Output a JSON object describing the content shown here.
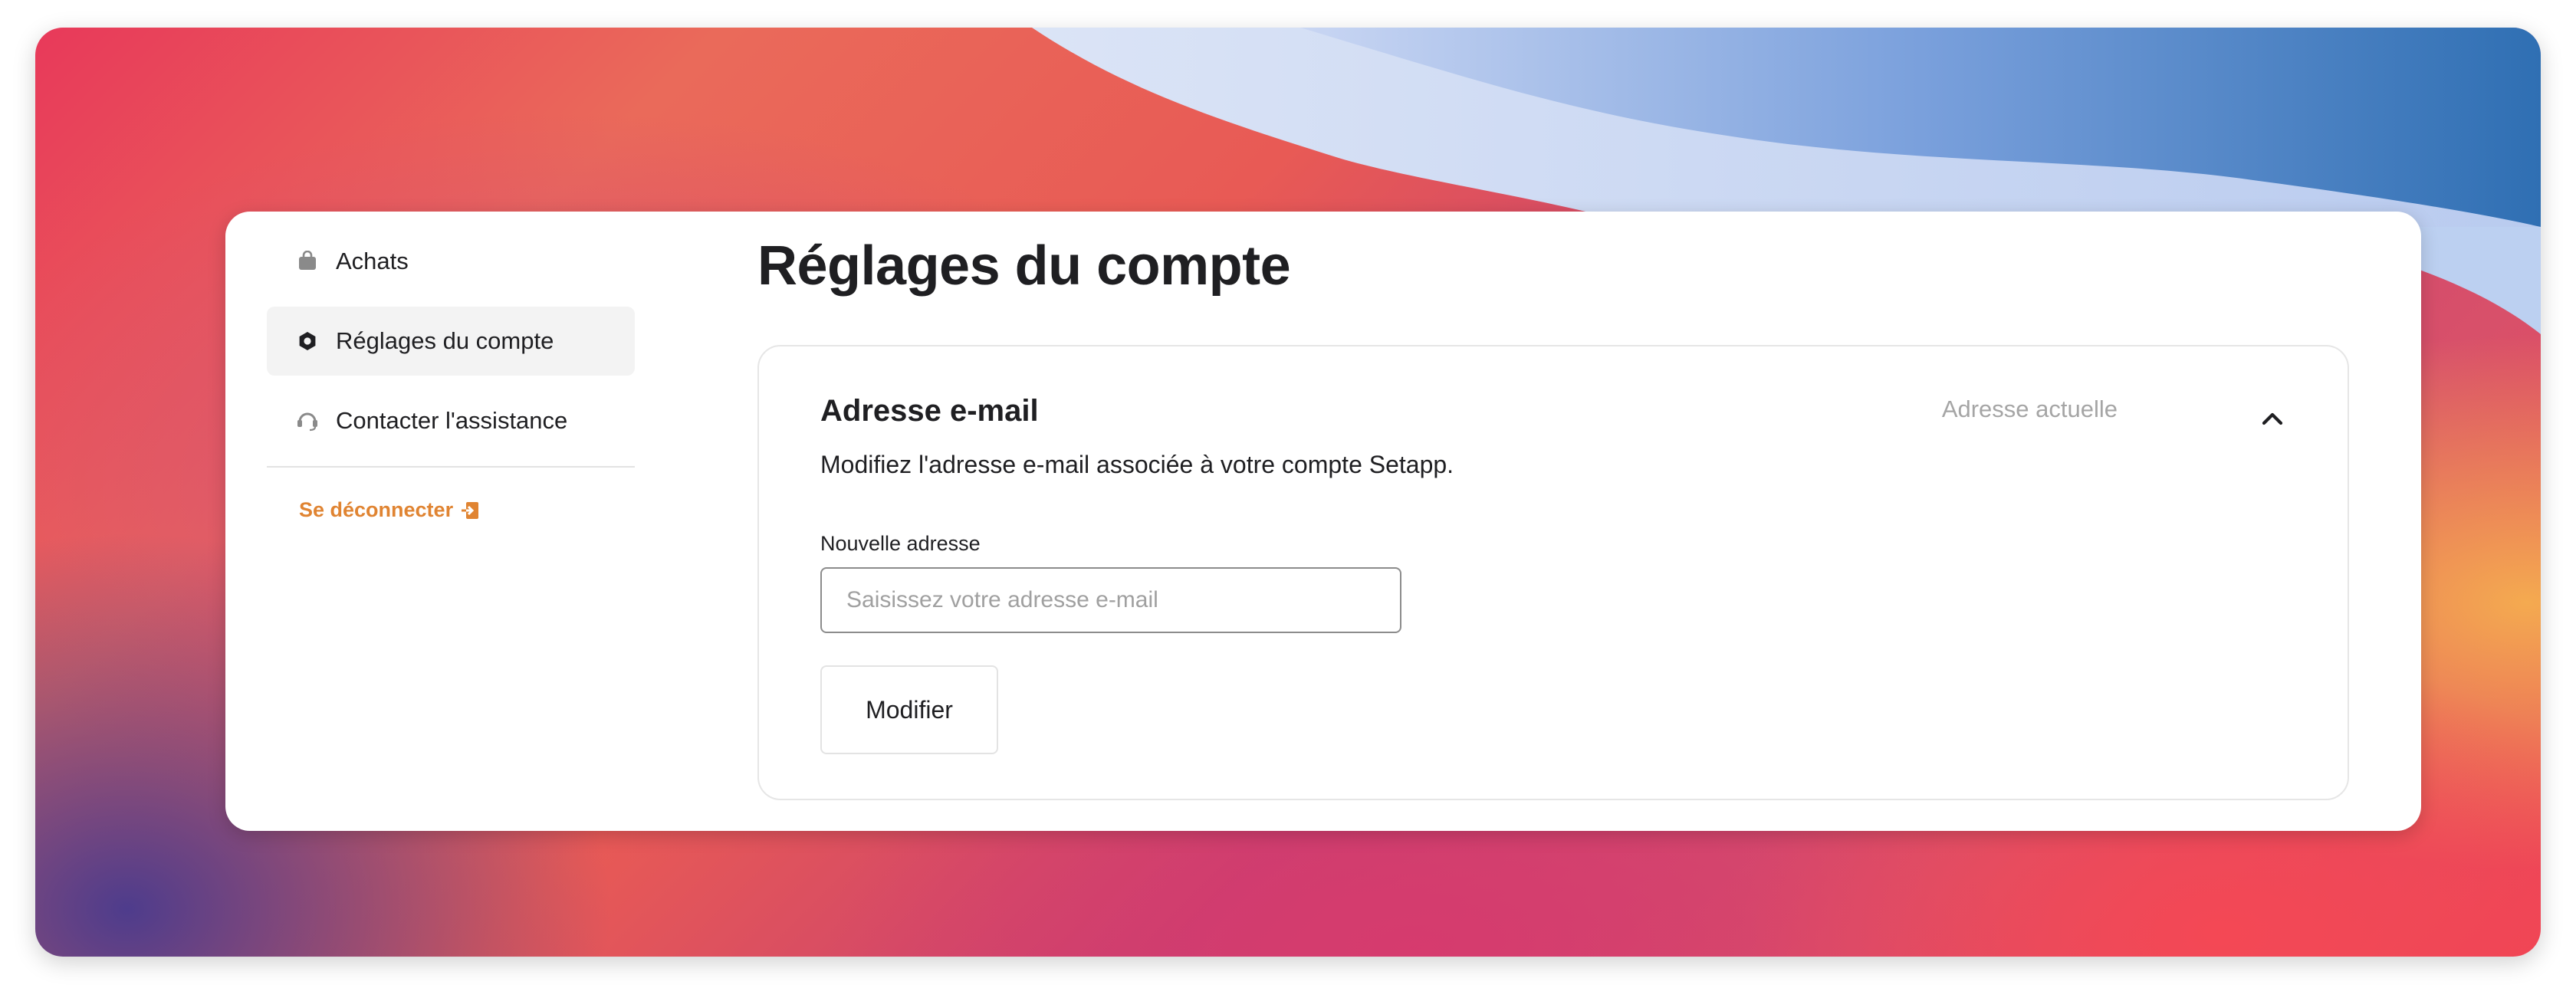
{
  "sidebar": {
    "items": [
      {
        "label": "Achats",
        "icon": "bag-icon",
        "active": false
      },
      {
        "label": "Réglages du compte",
        "icon": "gear-icon",
        "active": true
      },
      {
        "label": "Contacter l'assistance",
        "icon": "headset-icon",
        "active": false
      }
    ],
    "logout_label": "Se déconnecter",
    "logout_icon": "logout-icon"
  },
  "main": {
    "title": "Réglages du compte",
    "email_panel": {
      "title": "Adresse e-mail",
      "current_label": "Adresse actuelle",
      "toggle_icon": "chevron-up-icon",
      "description": "Modifiez l'adresse e-mail associée à votre compte Setapp.",
      "field_label": "Nouvelle adresse",
      "field_placeholder": "Saisissez votre adresse e-mail",
      "field_value": "",
      "submit_label": "Modifier"
    }
  },
  "colors": {
    "accent_orange": "#e08432",
    "text_primary": "#1f1f22",
    "text_muted": "#a5a5a5",
    "active_bg": "#f3f3f3"
  }
}
